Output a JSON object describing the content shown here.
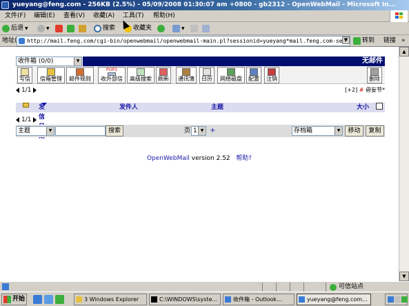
{
  "window": {
    "title": "yueyang@feng.com - 256KB (2.5%) - 05/09/2008 01:30:07 am +0800 - gb2312 - OpenWebMail - Microsoft In..."
  },
  "menu": {
    "items": [
      "文件(F)",
      "编辑(E)",
      "查看(V)",
      "收藏(A)",
      "工具(T)",
      "帮助(H)"
    ]
  },
  "toolbar": {
    "back": "后退",
    "search": "搜索",
    "favorites": "收藏夹"
  },
  "address": {
    "label": "地址(D)",
    "url": "http://mail.feng.com/cgi-bin/openwebmail/openwebmail-main.pl?sessionid=yueyang*mail.feng.com-sessio",
    "go": "转到",
    "links": "链接",
    "more": "»"
  },
  "mail": {
    "folder_selected": "收件箱  (0/0)",
    "banner": "无邮件",
    "icons": [
      "写信",
      "信箱管理",
      "邮件规则",
      "收外部信",
      "高级搜索",
      "刷新",
      "通讯簿",
      "日历",
      "网络磁盘",
      "配置",
      "注销",
      "删除"
    ],
    "icon_tags": {
      "pop3": "POP3"
    },
    "page_indicator": "1/1",
    "right_note_prefix": "[+2]",
    "right_note_hash": "#",
    "right_note_text": "毋妄节*",
    "columns": {
      "date": "发信日期",
      "sender": "发件人",
      "subject": "主题",
      "size": "大小"
    },
    "search_field": "主题",
    "search_button": "搜索",
    "page_label": "页",
    "page_value": "1",
    "plus": "+",
    "move_target": "存档箱",
    "move_button": "移动",
    "copy_button": "复制",
    "footer_product": "OpenWebMail",
    "footer_version": "version 2.52",
    "footer_help": "帮助?"
  },
  "status": {
    "zone": "可信站点"
  },
  "taskbar": {
    "start": "开始",
    "tasks": [
      "3 Windows Explorer",
      "C:\\WINDOWS\\syste...",
      "收件箱 - Outlook...",
      "yueyang@feng.com..."
    ]
  },
  "colors": {
    "banner_bg": "#000e6f",
    "header_bg": "#dcdcf0",
    "link": "#1a1aa8",
    "titlebar": "#0a246a"
  }
}
